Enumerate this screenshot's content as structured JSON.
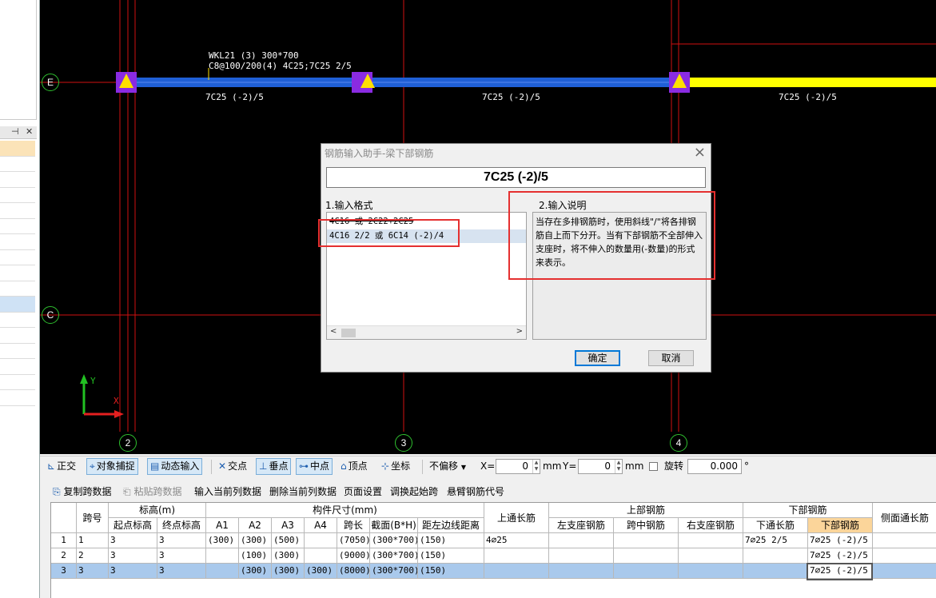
{
  "cad": {
    "beam_label_line1": "WKL21 (3)  300*700",
    "beam_label_line2": "C8@100/200(4) 4C25;7C25 2/5",
    "span_labels": [
      "7C25 (-2)/5",
      "7C25 (-2)/5",
      "7C25 (-2)/5"
    ],
    "axis_rows": [
      "E",
      "C"
    ],
    "axis_cols": [
      "2",
      "3",
      "4"
    ],
    "ucs_y": "Y",
    "ucs_x": "X",
    "colors": {
      "background": "#000000",
      "beam": "#1f5fd6",
      "beam_selected": "#ffff00",
      "gridline": "#d01010",
      "column": "#8a2be2",
      "axis_circle": "#2fbf2f"
    }
  },
  "dialog": {
    "title": "钢筋输入助手-梁下部钢筋",
    "input_value": "7C25 (-2)/5",
    "format_label": "1.输入格式",
    "format_items": [
      "4C16 或 2C22+2C25",
      "4C16 2/2 或 6C14 (-2)/4"
    ],
    "description_label": "2.输入说明",
    "description": "当存在多排钢筋时，使用斜线\"/\"将各排钢筋自上而下分开。当有下部钢筋不全部伸入支座时，将不伸入的数量用(-数量)的形式来表示。",
    "ok_label": "确定",
    "cancel_label": "取消"
  },
  "snap_toolbar": {
    "ortho": "正交",
    "object_snap": "对象捕捉",
    "dynamic_input": "动态输入",
    "intersection": "交点",
    "perpendicular": "垂点",
    "midpoint": "中点",
    "vertex": "顶点",
    "coordinate": "坐标",
    "offset_mode": "不偏移",
    "x_label": "X=",
    "x_value": "0",
    "x_unit": "mm",
    "y_label": "Y=",
    "y_value": "0",
    "y_unit": "mm",
    "rotate_label": "旋转",
    "rotate_value": "0.000",
    "degree": "°"
  },
  "action_toolbar": {
    "copy_span": "复制跨数据",
    "paste_span": "粘贴跨数据",
    "input_column": "输入当前列数据",
    "delete_column": "删除当前列数据",
    "page_setup": "页面设置",
    "swap_start": "调换起始跨",
    "cantilever_code": "悬臂钢筋代号"
  },
  "table": {
    "headers": {
      "span_no": "跨号",
      "elevation": "标高(m)",
      "start_elev": "起点标高",
      "end_elev": "终点标高",
      "size": "构件尺寸(mm)",
      "a1": "A1",
      "a2": "A2",
      "a3": "A3",
      "a4": "A4",
      "span_len": "跨长",
      "section": "截面(B*H)",
      "dist_left": "距左边线距离",
      "top_through": "上通长筋",
      "top_rebar": "上部钢筋",
      "left_support": "左支座钢筋",
      "mid_span": "跨中钢筋",
      "right_support": "右支座钢筋",
      "bottom_rebar": "下部钢筋",
      "bottom_through": "下通长筋",
      "bottom_rebar_col": "下部钢筋",
      "side_through": "侧面通长筋"
    },
    "rows": [
      {
        "n": "1",
        "span": "1",
        "start": "3",
        "end": "3",
        "a1": "(300)",
        "a2": "(300)",
        "a3": "(500)",
        "a4": "",
        "len": "(7050)",
        "section": "(300*700)",
        "dist": "(150)",
        "top_through": "4⌀25",
        "left": "",
        "mid": "",
        "right": "",
        "bottom_through": "7⌀25 2/5",
        "bottom": "7⌀25 (-2)/5",
        "side": ""
      },
      {
        "n": "2",
        "span": "2",
        "start": "3",
        "end": "3",
        "a1": "",
        "a2": "(100)",
        "a3": "(300)",
        "a4": "",
        "len": "(9000)",
        "section": "(300*700)",
        "dist": "(150)",
        "top_through": "",
        "left": "",
        "mid": "",
        "right": "",
        "bottom_through": "",
        "bottom": "7⌀25 (-2)/5",
        "side": ""
      },
      {
        "n": "3",
        "span": "3",
        "start": "3",
        "end": "3",
        "a1": "",
        "a2": "(300)",
        "a3": "(300)",
        "a4": "(300)",
        "len": "(8000)",
        "section": "(300*700)",
        "dist": "(150)",
        "top_through": "",
        "left": "",
        "mid": "",
        "right": "",
        "bottom_through": "",
        "bottom": "7⌀25 (-2)/5",
        "side": ""
      }
    ]
  }
}
